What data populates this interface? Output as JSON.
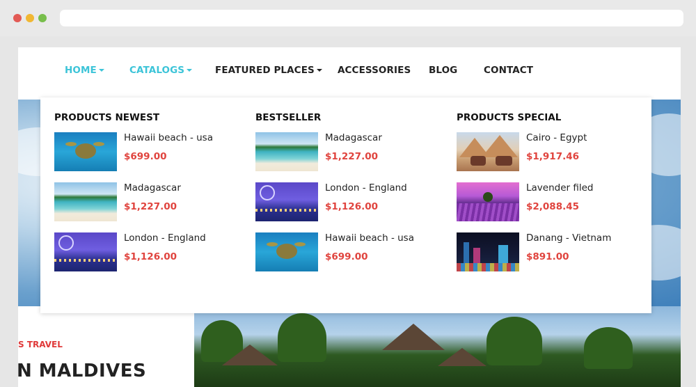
{
  "browser": {
    "close_button": "close",
    "minimize_button": "minimize",
    "zoom_button": "zoom"
  },
  "nav": {
    "items": [
      {
        "label": "HOME",
        "has_dropdown": true,
        "active": true
      },
      {
        "label": "CATALOGS",
        "has_dropdown": true,
        "active": true
      },
      {
        "label": "FEATURED PLACES",
        "has_dropdown": true,
        "active": false
      },
      {
        "label": "ACCESSORIES",
        "has_dropdown": false,
        "active": false
      },
      {
        "label": "BLOG",
        "has_dropdown": false,
        "active": false
      },
      {
        "label": "CONTACT",
        "has_dropdown": false,
        "active": false
      }
    ]
  },
  "mega_menu": {
    "columns": [
      {
        "title": "PRODUCTS NEWEST",
        "products": [
          {
            "name": "Hawaii beach - usa",
            "price": "$699.00",
            "image": "sea-turtle"
          },
          {
            "name": "Madagascar",
            "price": "$1,227.00",
            "image": "beach"
          },
          {
            "name": "London - England",
            "price": "$1,126.00",
            "image": "london-night"
          }
        ]
      },
      {
        "title": "BESTSELLER",
        "products": [
          {
            "name": "Madagascar",
            "price": "$1,227.00",
            "image": "beach"
          },
          {
            "name": "London - England",
            "price": "$1,126.00",
            "image": "london-night"
          },
          {
            "name": "Hawaii beach - usa",
            "price": "$699.00",
            "image": "sea-turtle"
          }
        ]
      },
      {
        "title": "PRODUCTS SPECIAL",
        "products": [
          {
            "name": "Cairo - Egypt",
            "price": "$1,917.46",
            "image": "pyramids"
          },
          {
            "name": "Lavender filed",
            "price": "$2,088.45",
            "image": "lavender-field"
          },
          {
            "name": "Danang - Vietnam",
            "price": "$891.00",
            "image": "danang-night"
          }
        ]
      }
    ]
  },
  "hero": {
    "tag": "S TRAVEL",
    "title": "N MALDIVES"
  },
  "colors": {
    "accent": "#3cc4d8",
    "price": "#e0443e",
    "text": "#222222"
  }
}
